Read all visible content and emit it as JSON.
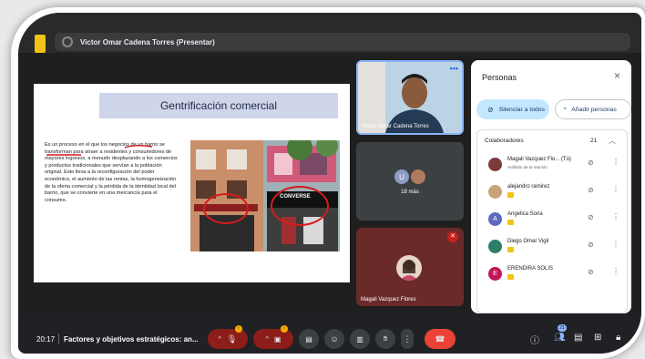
{
  "presenter": {
    "label": "Victor Omar Cadena Torres (Presentar)"
  },
  "slide": {
    "title": "Gentrificación comercial",
    "body": "Es un proceso en el que los negocios de un barrio se transforman para atraer a residentes y consumidores de mayores ingresos, a menudo desplazando a los comercios y productos tradicionales que servían a la población original. Esto lleva a la reconfiguración del poder económico, el aumento de las rentas, la homogeneización de la oferta comercial y la pérdida de la identidad local del barrio, que se convierte en una mercancía para el consumo.",
    "store_sign": "CONVERSE"
  },
  "tiles": {
    "me_label": "Victor Omar Cadena Torres",
    "more_count": "18 más",
    "more_initial": "U",
    "magali_label": "Magali Vazquez Flores"
  },
  "panel": {
    "title": "Personas",
    "close": "×",
    "silence_all": "Silenciar a todos",
    "add_people": "Añadir personas",
    "collab_title": "Colaboradores",
    "collab_count": "21",
    "participants": [
      {
        "name": "Magali Vazquez Flo... (Tú)",
        "sub": "Anfitrión de la reunión",
        "initial": "",
        "color": "#7a3b3b"
      },
      {
        "name": "alejandro ramirez",
        "sub": "",
        "initial": "",
        "color": "#c9a27a"
      },
      {
        "name": "Angelica Soria",
        "sub": "",
        "initial": "A",
        "color": "#5c6bc0"
      },
      {
        "name": "Diego Omar Vigil",
        "sub": "",
        "initial": "",
        "color": "#2e7d6b"
      },
      {
        "name": "ERENDIRA SOLIS",
        "sub": "",
        "initial": "E",
        "color": "#c2185b"
      }
    ]
  },
  "bottom": {
    "time": "20:17",
    "meeting_title": "Factores y objetivos estratégicos: an...",
    "people_badge": "21"
  }
}
